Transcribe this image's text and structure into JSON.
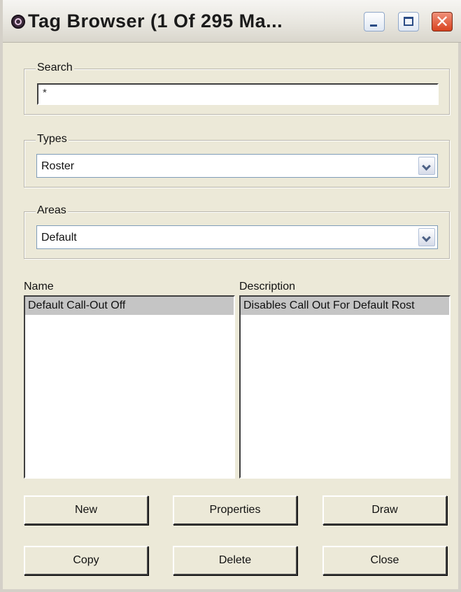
{
  "window": {
    "title": "Tag Browser (1 Of 295 Ma...",
    "close_glyph": "✕",
    "icons": {
      "app": "app-icon",
      "minimize": "minimize-icon",
      "maximize": "maximize-icon",
      "close": "close-icon"
    },
    "colors": {
      "close_button": "#d8421f",
      "background": "#ece9d8"
    }
  },
  "search": {
    "label": "Search",
    "value": "*"
  },
  "types": {
    "label": "Types",
    "selected": "Roster"
  },
  "areas": {
    "label": "Areas",
    "selected": "Default"
  },
  "list": {
    "name_header": "Name",
    "description_header": "Description",
    "rows": [
      {
        "name": "Default Call-Out Off",
        "description": "Disables Call Out For Default Rost"
      }
    ]
  },
  "buttons": {
    "new": "New",
    "properties": "Properties",
    "draw": "Draw",
    "copy": "Copy",
    "delete": "Delete",
    "close": "Close"
  }
}
